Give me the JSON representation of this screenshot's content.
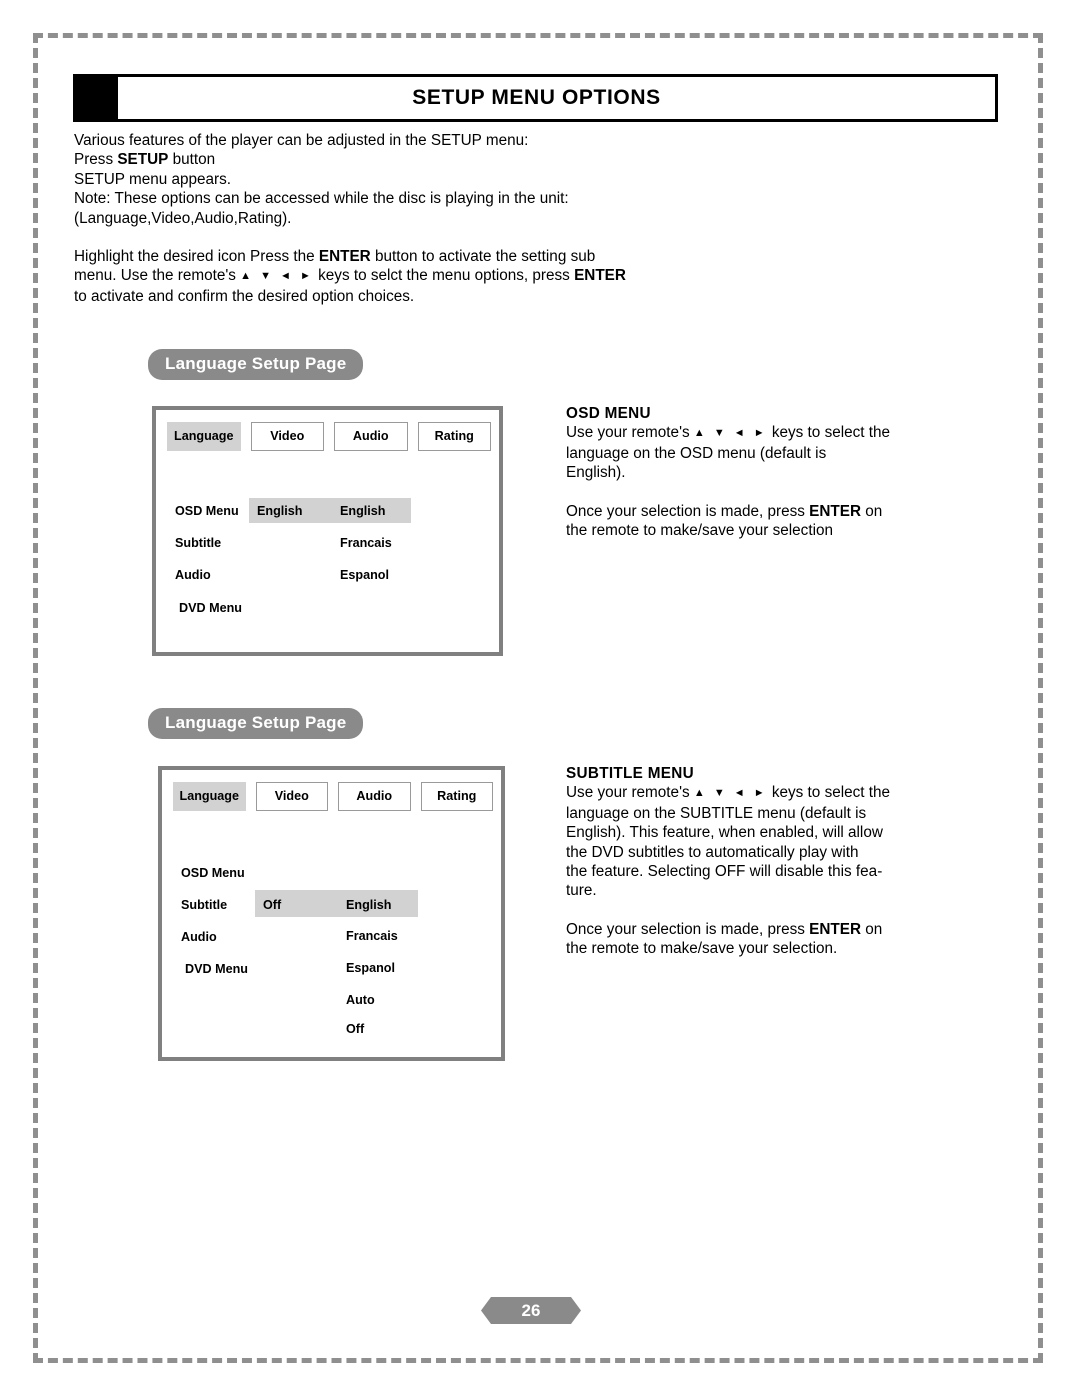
{
  "header": {
    "title": "SETUP MENU OPTIONS"
  },
  "intro": {
    "line1": "Various features of the player can be adjusted in the SETUP menu:",
    "line2_pre": "Press ",
    "line2_bold": "SETUP",
    "line2_post": " button",
    "line3": "SETUP menu appears.",
    "line4": "Note: These options can be accessed while the disc is playing in the unit:",
    "line5": "(Language,Video,Audio,Rating).",
    "para2_a": "Highlight the desired icon Press the ",
    "para2_b": "ENTER",
    "para2_c": " button to activate the setting sub",
    "para2_d": "menu. Use the remote's ",
    "para2_arrows": "▲ ▼ ◄ ►",
    "para2_e": " keys to selct the menu options, press ",
    "para2_f": "ENTER",
    "para2_g": "to activate and confirm the desired option choices."
  },
  "sections": [
    {
      "badge": "Language Setup Page",
      "tabs": [
        {
          "label": "Language",
          "active": true
        },
        {
          "label": "Video",
          "active": false
        },
        {
          "label": "Audio",
          "active": false
        },
        {
          "label": "Rating",
          "active": false
        }
      ],
      "left_items": [
        "OSD Menu",
        "Subtitle",
        "Audio",
        "DVD Menu"
      ],
      "mid_items": [
        "English"
      ],
      "right_items": [
        "English",
        "Francais",
        "Espanol"
      ],
      "highlight_row_index": 0
    },
    {
      "badge": "Language Setup Page",
      "tabs": [
        {
          "label": "Language",
          "active": true
        },
        {
          "label": "Video",
          "active": false
        },
        {
          "label": "Audio",
          "active": false
        },
        {
          "label": "Rating",
          "active": false
        }
      ],
      "left_items": [
        "OSD Menu",
        "Subtitle",
        "Audio",
        "DVD Menu"
      ],
      "mid_items": [
        "Off"
      ],
      "right_items": [
        "English",
        "Francais",
        "Espanol",
        "Auto",
        "Off"
      ],
      "highlight_row_index": 1
    }
  ],
  "desc_osd": {
    "heading": "OSD MENU",
    "line_a": "Use your remote's ",
    "arrows": "▲ ▼ ◄ ►",
    "line_b": " keys to select the",
    "line_c": "language on the OSD menu (default is",
    "line_d": "English).",
    "line_e_pre": "Once your selection is made, press ",
    "line_e_bold": "ENTER",
    "line_e_post": " on",
    "line_f": "the remote to make/save your selection"
  },
  "desc_sub": {
    "heading": "SUBTITLE MENU",
    "line_a": "Use your remote's ",
    "arrows": "▲ ▼ ◄ ►",
    "line_b": " keys to select the",
    "line_c": "language on the SUBTITLE menu (default is",
    "line_d": "English). This feature, when enabled, will allow",
    "line_e": "the DVD subtitles to automatically play with",
    "line_f": "the feature. Selecting OFF will disable this fea-",
    "line_g": "ture.",
    "line_h_pre": "Once your selection is made, press ",
    "line_h_bold": "ENTER",
    "line_h_post": " on",
    "line_i": "the remote to make/save your selection."
  },
  "footer": {
    "page_number": "26"
  },
  "colors": {
    "frame_dash": "#8f8f8f",
    "badge_gray": "#8a8a8a",
    "box_border": "#808080",
    "highlight": "#d2d2d2"
  }
}
